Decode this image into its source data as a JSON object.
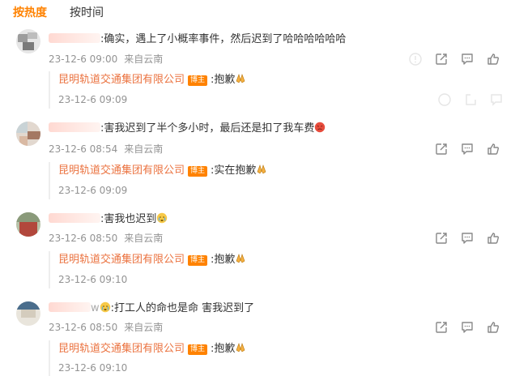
{
  "tabs": {
    "hot": "按热度",
    "time": "按时间"
  },
  "comments": [
    {
      "text": ":确实，遇上了小概率事件，然后迟到了哈哈哈哈哈哈",
      "date": "23-12-6 09:00",
      "location": "来自云南",
      "reply": {
        "name": "昆明轨道交通集团有限公司",
        "badge": "博主",
        "text": ":抱歉",
        "date": "23-12-6 09:09"
      }
    },
    {
      "text": ":害我迟到了半个多小时，最后还是扣了我车费",
      "date": "23-12-6 08:54",
      "location": "来自云南",
      "reply": {
        "name": "昆明轨道交通集团有限公司",
        "badge": "博主",
        "text": ":实在抱歉",
        "date": "23-12-6 09:09"
      }
    },
    {
      "text": ":害我也迟到",
      "date": "23-12-6 08:50",
      "location": "来自云南",
      "reply": {
        "name": "昆明轨道交通集团有限公司",
        "badge": "博主",
        "text": ":抱歉",
        "date": "23-12-6 09:10"
      }
    },
    {
      "name_visible": "w",
      "text": ":打工人的命也是命 害我迟到了",
      "date": "23-12-6 08:50",
      "location": "来自云南",
      "reply": {
        "name": "昆明轨道交通集团有限公司",
        "badge": "博主",
        "text": ":抱歉",
        "date": "23-12-6 09:10"
      }
    }
  ],
  "icons": {
    "report": "report-icon",
    "share": "share-icon",
    "comment": "comment-icon",
    "like": "like-icon",
    "pray_emoji": "pray-emoji",
    "angry_emoji": "angry-face-emoji",
    "crying_emoji": "crying-face-emoji"
  },
  "colors": {
    "accent": "#ff8200",
    "reply_name": "#eb7340",
    "meta": "#939393"
  }
}
